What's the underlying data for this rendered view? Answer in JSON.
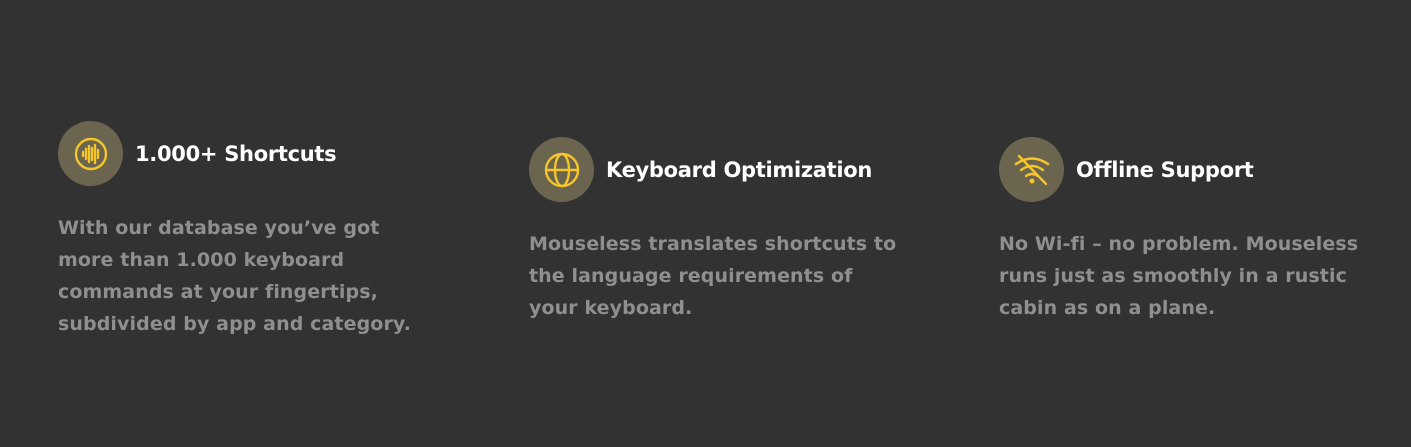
{
  "accent_color": "#f5c62a",
  "icon_background": "#6b6550",
  "features": [
    {
      "icon": "soundwave-circle-icon",
      "title": "1.000+ Shortcuts",
      "description": "With our database you’ve got more than 1.000 keyboard commands at your fingertips, subdivided by app and category."
    },
    {
      "icon": "globe-icon",
      "title": "Keyboard Optimization",
      "description": "Mouseless translates shortcuts to the language requirements of your keyboard."
    },
    {
      "icon": "wifi-off-icon",
      "title": "Offline Support",
      "description": "No Wi-fi – no problem. Mouseless runs just as smoothly in a rustic cabin as on a plane."
    }
  ]
}
